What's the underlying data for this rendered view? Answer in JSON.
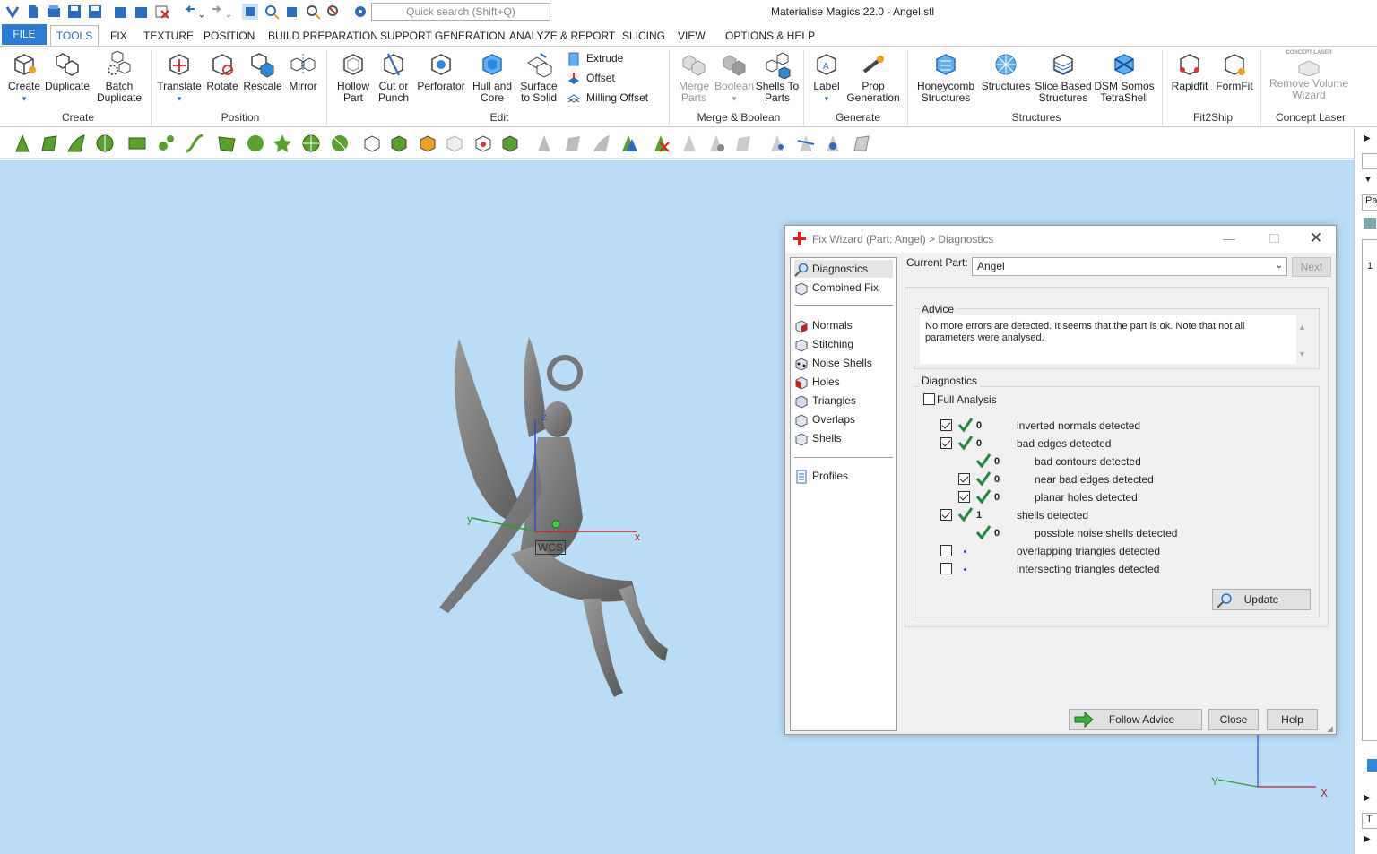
{
  "app": {
    "title": "Materialise Magics 22.0 - Angel.stl",
    "search_placeholder": "Quick search (Shift+Q)"
  },
  "menu": {
    "file": "FILE",
    "tools": "TOOLS",
    "fix": "FIX",
    "texture": "TEXTURE",
    "position": "POSITION",
    "build": "BUILD PREPARATION",
    "support": "SUPPORT GENERATION",
    "analyze": "ANALYZE & REPORT",
    "slicing": "SLICING",
    "view": "VIEW",
    "options": "OPTIONS & HELP"
  },
  "ribbon": {
    "create": "Create",
    "duplicate": "Duplicate",
    "batch": "Batch Duplicate",
    "translate": "Translate",
    "rotate": "Rotate",
    "rescale": "Rescale",
    "mirror": "Mirror",
    "hollow": "Hollow Part",
    "cut": "Cut or Punch",
    "perforator": "Perforator",
    "hull": "Hull and Core",
    "surface": "Surface to Solid",
    "extrude": "Extrude",
    "offset": "Offset",
    "milling": "Milling Offset",
    "merge": "Merge Parts",
    "boolean": "Boolean",
    "shells": "Shells To Parts",
    "label": "Label",
    "prop": "Prop Generation",
    "honeycomb": "Honeycomb Structures",
    "structures": "Structures",
    "slice": "Slice Based Structures",
    "dsm": "DSM Somos TetraShell",
    "rapidfit": "Rapidfit",
    "formfit": "FormFit",
    "remove": "Remove Volume Wizard",
    "laser_logo": "CONCEPT LASER",
    "groups": {
      "create": "Create",
      "position": "Position",
      "edit": "Edit",
      "merge": "Merge & Boolean",
      "generate": "Generate",
      "structures": "Structures",
      "fit2ship": "Fit2Ship",
      "laser": "Concept Laser"
    }
  },
  "viewport": {
    "wcs": "WCS",
    "x": "x",
    "y": "y",
    "z": "z",
    "x2": "X",
    "y2": "Y"
  },
  "right_strip": {
    "pa": "Pa",
    "one": "1",
    "t": "T"
  },
  "dialog": {
    "title": "Fix Wizard (Part: Angel) > Diagnostics",
    "nav": {
      "diagnostics": "Diagnostics",
      "combined": "Combined Fix",
      "normals": "Normals",
      "stitching": "Stitching",
      "noise": "Noise Shells",
      "holes": "Holes",
      "triangles": "Triangles",
      "overlaps": "Overlaps",
      "shells": "Shells",
      "profiles": "Profiles"
    },
    "current_part_label": "Current Part:",
    "current_part": "Angel",
    "next": "Next",
    "advice_legend": "Advice",
    "advice_text": "No more errors are detected. It seems that the part is ok. Note that not all parameters were analysed.",
    "diag_legend": "Diagnostics",
    "full_analysis": "Full Analysis",
    "rows": [
      {
        "count": "0",
        "label": "inverted normals detected"
      },
      {
        "count": "0",
        "label": "bad edges detected"
      },
      {
        "count": "0",
        "label": "bad contours detected"
      },
      {
        "count": "0",
        "label": "near bad edges detected"
      },
      {
        "count": "0",
        "label": "planar holes detected"
      },
      {
        "count": "1",
        "label": "shells detected"
      },
      {
        "count": "0",
        "label": "possible noise shells detected"
      },
      {
        "count": "",
        "label": "overlapping triangles detected"
      },
      {
        "count": "",
        "label": "intersecting triangles detected"
      }
    ],
    "update": "Update",
    "follow": "Follow Advice",
    "close": "Close",
    "help": "Help"
  }
}
